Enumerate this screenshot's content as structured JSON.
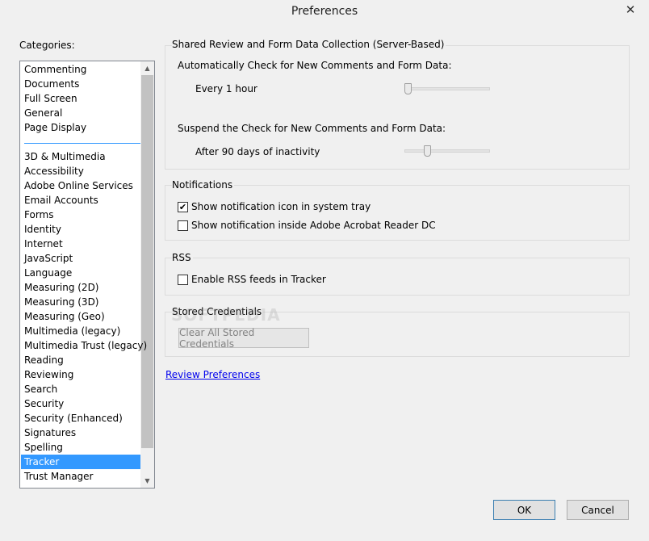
{
  "window": {
    "title": "Preferences",
    "close_glyph": "✕"
  },
  "categories": {
    "label": "Categories:",
    "group1": [
      "Commenting",
      "Documents",
      "Full Screen",
      "General",
      "Page Display"
    ],
    "group2": [
      "3D & Multimedia",
      "Accessibility",
      "Adobe Online Services",
      "Email Accounts",
      "Forms",
      "Identity",
      "Internet",
      "JavaScript",
      "Language",
      "Measuring (2D)",
      "Measuring (3D)",
      "Measuring (Geo)",
      "Multimedia (legacy)",
      "Multimedia Trust (legacy)",
      "Reading",
      "Reviewing",
      "Search",
      "Security",
      "Security (Enhanced)",
      "Signatures",
      "Spelling",
      "Tracker",
      "Trust Manager"
    ],
    "selected": "Tracker",
    "selection_color": "#3399ff"
  },
  "shared_review": {
    "title": "Shared Review and Form Data Collection (Server-Based)",
    "auto_check_label": "Automatically Check for New Comments and Form Data:",
    "auto_check_value": "Every 1 hour",
    "auto_check_level": 0.0,
    "suspend_label": "Suspend the Check for New Comments and Form Data:",
    "suspend_value": "After 90 days of inactivity",
    "suspend_level": 0.25
  },
  "notifications": {
    "title": "Notifications",
    "system_tray_label": "Show notification icon in system tray",
    "system_tray_checked": true,
    "inside_reader_label": "Show notification inside Adobe Acrobat Reader DC",
    "inside_reader_checked": false
  },
  "rss": {
    "title": "RSS",
    "enable_label": "Enable RSS feeds in Tracker",
    "enable_checked": false
  },
  "stored_credentials": {
    "title": "Stored Credentials",
    "clear_label": "Clear All Stored Credentials"
  },
  "review_link": "Review Preferences",
  "footer": {
    "ok_label": "OK",
    "cancel_label": "Cancel"
  },
  "watermark": "SOFTPEDIA"
}
